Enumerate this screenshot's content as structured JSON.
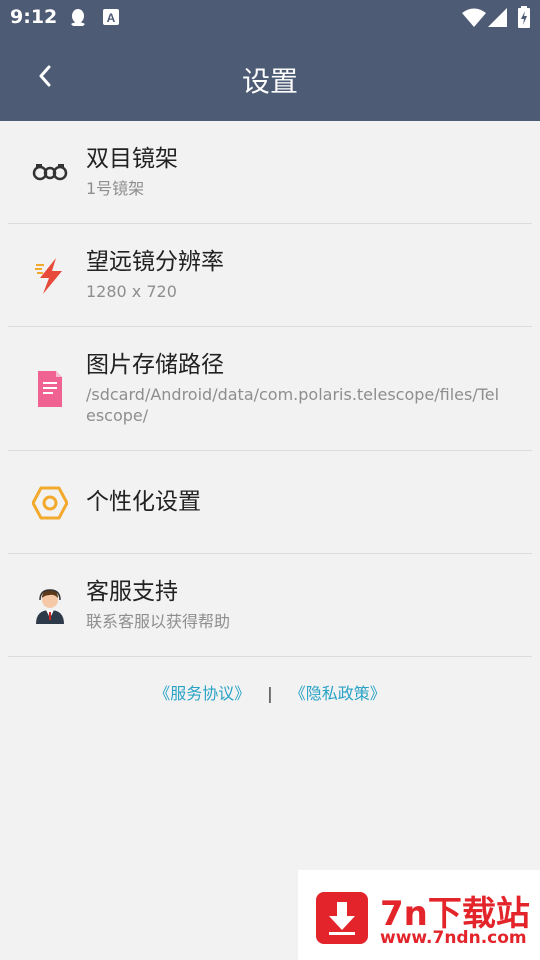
{
  "status_bar": {
    "time": "9:12",
    "icons": [
      "qq-icon",
      "a-icon",
      "wifi-icon",
      "signal-icon",
      "battery-charging-icon"
    ]
  },
  "app_bar": {
    "title": "设置",
    "back_icon": "chevron-left-icon",
    "background": "#4d5b74"
  },
  "settings": [
    {
      "icon": "binoculars-icon",
      "title": "双目镜架",
      "subtitle": "1号镜架"
    },
    {
      "icon": "lightning-icon",
      "title": "望远镜分辨率",
      "subtitle": "1280 x 720"
    },
    {
      "icon": "document-icon",
      "title": "图片存储路径",
      "subtitle": "/sdcard/Android/data/com.polaris.telescope/files/Telescope/"
    },
    {
      "icon": "hexagon-settings-icon",
      "title": "个性化设置",
      "subtitle": ""
    },
    {
      "icon": "customer-service-icon",
      "title": "客服支持",
      "subtitle": "联系客服以获得帮助"
    }
  ],
  "links": {
    "service_agreement": "《服务协议》",
    "separator": "|",
    "privacy_policy": "《隐私政策》",
    "color": "#2aa3c6"
  },
  "watermark": {
    "title": "7n下载站",
    "url": "www.7ndn.com",
    "color": "#e3252b"
  }
}
